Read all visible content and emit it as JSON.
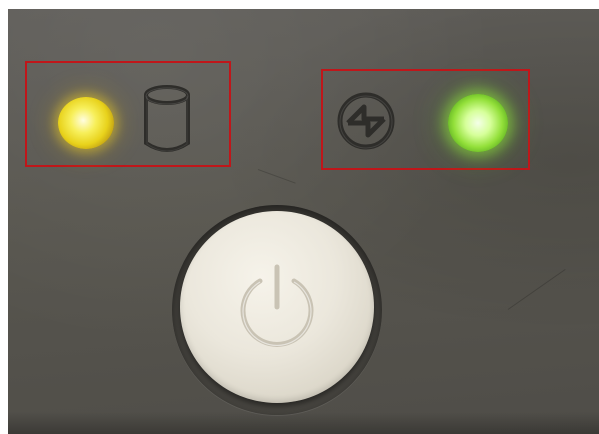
{
  "scene": {
    "subject": "device-front-panel",
    "panel_color": "#5a5853",
    "highlight_color": "#c0161a"
  },
  "indicators": [
    {
      "name": "disk-activity",
      "led_color": "yellow",
      "led_hex": "#f2e23a",
      "lit": true,
      "icon": "hard-disk-icon",
      "highlighted": true
    },
    {
      "name": "network-activity",
      "led_color": "green",
      "led_hex": "#b6f25a",
      "lit": true,
      "icon": "network-link-icon",
      "highlighted": true
    }
  ],
  "power_button": {
    "icon": "power-icon",
    "button_color": "#ece8de"
  }
}
